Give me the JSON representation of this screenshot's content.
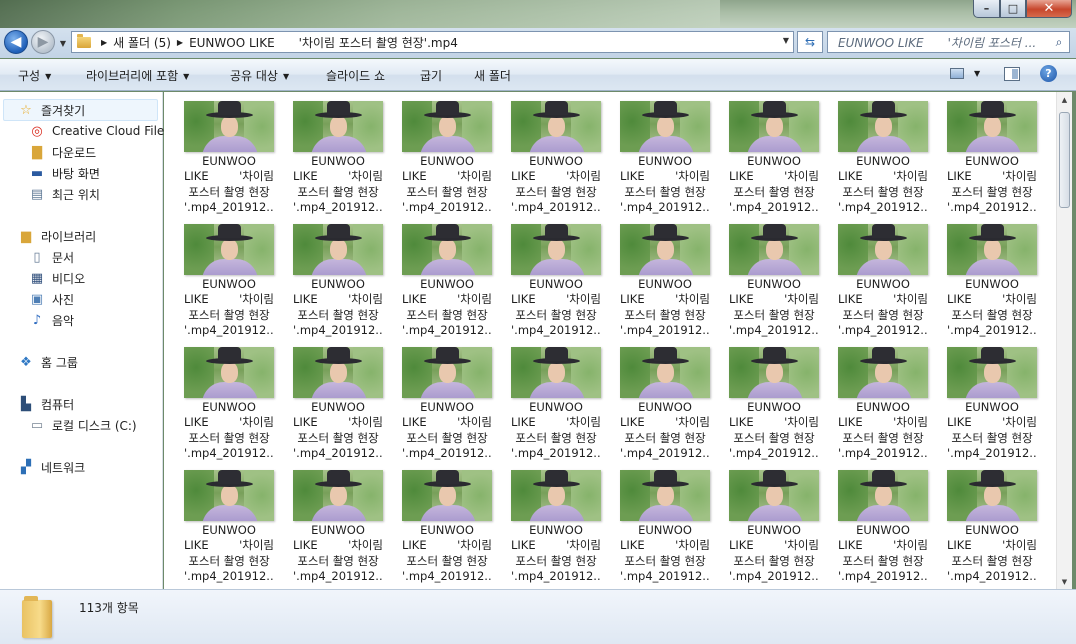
{
  "window": {
    "controls": {
      "minimize": "–",
      "maximize": "□",
      "close": "✕"
    }
  },
  "address": {
    "back_icon": "arrow-left",
    "forward_icon": "arrow-right",
    "breadcrumbs": [
      "새 폴더 (5)",
      "EUNWOO LIKE　　'차이림 포스터 촬영 현장'.mp4"
    ],
    "search_placeholder": "EUNWOO LIKE　　'차이림 포스터 ..."
  },
  "toolbar": {
    "items": [
      "구성",
      "라이브러리에 포함",
      "공유 대상",
      "슬라이드 쇼",
      "굽기",
      "새 폴더"
    ]
  },
  "nav": {
    "favorites": {
      "label": "즐겨찾기",
      "items": [
        "Creative Cloud Files",
        "다운로드",
        "바탕 화면",
        "최근 위치"
      ]
    },
    "libraries": {
      "label": "라이브러리",
      "items": [
        "문서",
        "비디오",
        "사진",
        "음악"
      ]
    },
    "homegroup": "홈 그룹",
    "computer": {
      "label": "컴퓨터",
      "items": [
        "로컬 디스크 (C:)"
      ]
    },
    "network": "네트워크"
  },
  "files": {
    "line1": "EUNWOO",
    "line2a": "LIKE",
    "line2b": "'차이림",
    "line3": "포스터 촬영 현장",
    "line4": "'.mp4_201912...",
    "columns": 8,
    "rows": 4
  },
  "status": {
    "item_count": "113개 항목"
  },
  "colors": {
    "accent": "#1d55a8",
    "nav_bg": "#ffffff",
    "cmdbar": "#dce7f2"
  }
}
